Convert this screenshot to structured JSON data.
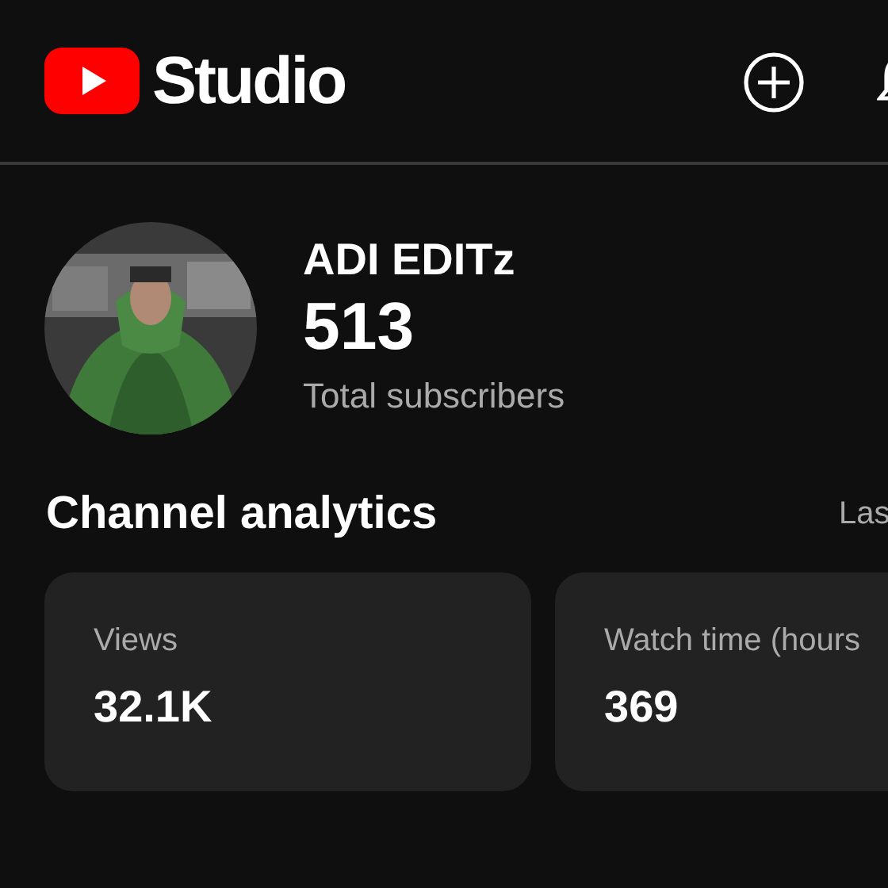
{
  "header": {
    "logo_text": "Studio"
  },
  "channel": {
    "name": "ADI EDITz",
    "subscribers": "513",
    "subscribers_label": "Total subscribers"
  },
  "analytics": {
    "title": "Channel analytics",
    "period": "Las",
    "cards": [
      {
        "label": "Views",
        "value": "32.1K"
      },
      {
        "label": "Watch time (hours",
        "value": "369"
      }
    ]
  }
}
